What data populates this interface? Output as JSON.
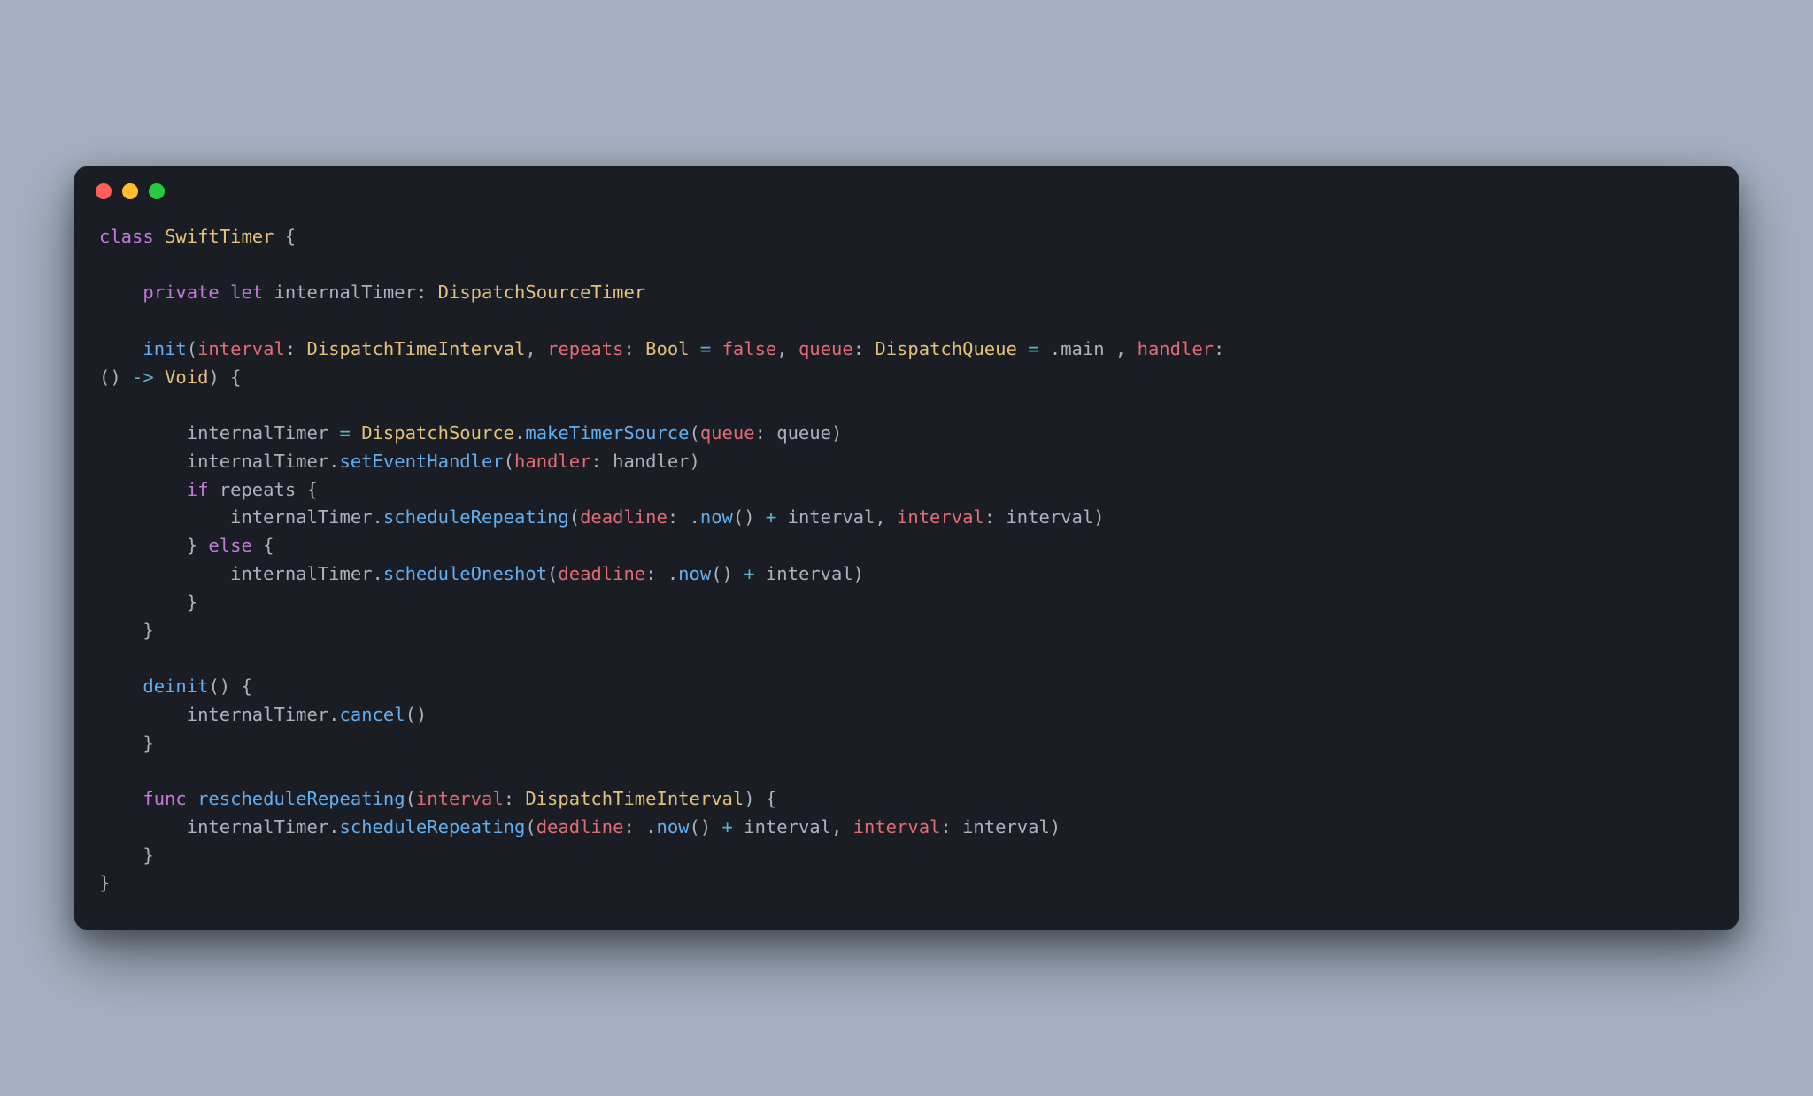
{
  "window": {
    "background": "#1b1d25",
    "traffic_lights": {
      "close": "#ff5f56",
      "minimize": "#ffbd2e",
      "maximize": "#27c93f"
    }
  },
  "syntax_colors": {
    "keyword": "#c678dd",
    "type": "#e5c07b",
    "function": "#61afef",
    "param_label": "#e06c75",
    "literal": "#d19a66",
    "false": "#e06c75",
    "punct": "#abb2bf",
    "default_text": "#abb2bf"
  },
  "code": {
    "language": "swift",
    "tokens": [
      [
        [
          "keyword",
          "class"
        ],
        [
          "punct",
          " "
        ],
        [
          "type",
          "SwiftTimer"
        ],
        [
          "punct",
          " {"
        ]
      ],
      [],
      [
        [
          "punct",
          "    "
        ],
        [
          "keyword",
          "private"
        ],
        [
          "punct",
          " "
        ],
        [
          "keyword",
          "let"
        ],
        [
          "punct",
          " "
        ],
        [
          "ident",
          "internalTimer: "
        ],
        [
          "type",
          "DispatchSourceTimer"
        ]
      ],
      [],
      [
        [
          "punct",
          "    "
        ],
        [
          "func",
          "init"
        ],
        [
          "punct",
          "("
        ],
        [
          "param",
          "interval"
        ],
        [
          "punct",
          ": "
        ],
        [
          "type",
          "DispatchTimeInterval"
        ],
        [
          "punct",
          ", "
        ],
        [
          "param",
          "repeats"
        ],
        [
          "punct",
          ": "
        ],
        [
          "type",
          "Bool"
        ],
        [
          "punct",
          " "
        ],
        [
          "cyan",
          "="
        ],
        [
          "punct",
          " "
        ],
        [
          "boolfalse",
          "false"
        ],
        [
          "punct",
          ", "
        ],
        [
          "param",
          "queue"
        ],
        [
          "punct",
          ": "
        ],
        [
          "type",
          "DispatchQueue"
        ],
        [
          "punct",
          " "
        ],
        [
          "cyan",
          "="
        ],
        [
          "punct",
          " ."
        ],
        [
          "ident",
          "main "
        ],
        [
          "punct",
          ", "
        ],
        [
          "param",
          "handler"
        ],
        [
          "punct",
          ": "
        ]
      ],
      [
        [
          "punct",
          "() "
        ],
        [
          "cyan",
          "->"
        ],
        [
          "punct",
          " "
        ],
        [
          "type",
          "Void"
        ],
        [
          "punct",
          ") {"
        ]
      ],
      [],
      [
        [
          "punct",
          "        internalTimer "
        ],
        [
          "cyan",
          "="
        ],
        [
          "punct",
          " "
        ],
        [
          "type",
          "DispatchSource"
        ],
        [
          "punct",
          "."
        ],
        [
          "func",
          "makeTimerSource"
        ],
        [
          "punct",
          "("
        ],
        [
          "param",
          "queue"
        ],
        [
          "punct",
          ": queue)"
        ]
      ],
      [
        [
          "punct",
          "        internalTimer."
        ],
        [
          "func",
          "setEventHandler"
        ],
        [
          "punct",
          "("
        ],
        [
          "param",
          "handler"
        ],
        [
          "punct",
          ": handler)"
        ]
      ],
      [
        [
          "punct",
          "        "
        ],
        [
          "keyword",
          "if"
        ],
        [
          "punct",
          " repeats {"
        ]
      ],
      [
        [
          "punct",
          "            internalTimer."
        ],
        [
          "func",
          "scheduleRepeating"
        ],
        [
          "punct",
          "("
        ],
        [
          "param",
          "deadline"
        ],
        [
          "punct",
          ": ."
        ],
        [
          "func",
          "now"
        ],
        [
          "punct",
          "() "
        ],
        [
          "cyan",
          "+"
        ],
        [
          "punct",
          " interval, "
        ],
        [
          "param",
          "interval"
        ],
        [
          "punct",
          ": interval)"
        ]
      ],
      [
        [
          "punct",
          "        } "
        ],
        [
          "keyword",
          "else"
        ],
        [
          "punct",
          " {"
        ]
      ],
      [
        [
          "punct",
          "            internalTimer."
        ],
        [
          "func",
          "scheduleOneshot"
        ],
        [
          "punct",
          "("
        ],
        [
          "param",
          "deadline"
        ],
        [
          "punct",
          ": ."
        ],
        [
          "func",
          "now"
        ],
        [
          "punct",
          "() "
        ],
        [
          "cyan",
          "+"
        ],
        [
          "punct",
          " interval)"
        ]
      ],
      [
        [
          "punct",
          "        }"
        ]
      ],
      [
        [
          "punct",
          "    }"
        ]
      ],
      [],
      [
        [
          "punct",
          "    "
        ],
        [
          "func",
          "deinit"
        ],
        [
          "punct",
          "() {"
        ]
      ],
      [
        [
          "punct",
          "        internalTimer."
        ],
        [
          "func",
          "cancel"
        ],
        [
          "punct",
          "()"
        ]
      ],
      [
        [
          "punct",
          "    }"
        ]
      ],
      [],
      [
        [
          "punct",
          "    "
        ],
        [
          "keyword",
          "func"
        ],
        [
          "punct",
          " "
        ],
        [
          "func",
          "rescheduleRepeating"
        ],
        [
          "punct",
          "("
        ],
        [
          "param",
          "interval"
        ],
        [
          "punct",
          ": "
        ],
        [
          "type",
          "DispatchTimeInterval"
        ],
        [
          "punct",
          ") {"
        ]
      ],
      [
        [
          "punct",
          "        internalTimer."
        ],
        [
          "func",
          "scheduleRepeating"
        ],
        [
          "punct",
          "("
        ],
        [
          "param",
          "deadline"
        ],
        [
          "punct",
          ": ."
        ],
        [
          "func",
          "now"
        ],
        [
          "punct",
          "() "
        ],
        [
          "cyan",
          "+"
        ],
        [
          "punct",
          " interval, "
        ],
        [
          "param",
          "interval"
        ],
        [
          "punct",
          ": interval)"
        ]
      ],
      [
        [
          "punct",
          "    }"
        ]
      ],
      [
        [
          "punct",
          "}"
        ]
      ]
    ]
  }
}
